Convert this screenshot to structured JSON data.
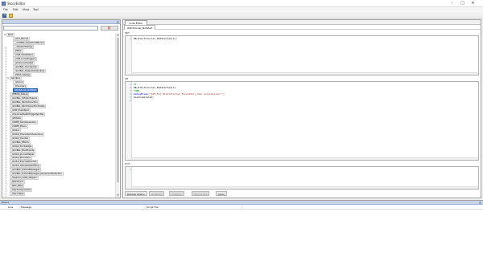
{
  "window": {
    "title": "StoryEditor",
    "controls": [
      "–",
      "□",
      "✕"
    ]
  },
  "menu": [
    "File",
    "Edit",
    "View",
    "Tool"
  ],
  "toolbar": {
    "icons": [
      "save-icon",
      "open-icon"
    ]
  },
  "left_panel": {
    "close_glyph": "✕",
    "search": {
      "value": "",
      "placeholder": ""
    },
    "clear_glyph": "✕",
    "tree": [
      {
        "indent": 0,
        "twisty": "⊟",
        "label": "Root"
      },
      {
        "indent": 2,
        "twisty": "",
        "label": "_GLO_Shroud"
      },
      {
        "indent": 2,
        "twisty": "",
        "label": "__GLOBAL_EquipmentBonus"
      },
      {
        "indent": 2,
        "twisty": "",
        "label": "__DesertoDialogs"
      },
      {
        "indent": 2,
        "twisty": "",
        "label": "_PROC"
      },
      {
        "indent": 2,
        "twisty": "",
        "label": "_CSM_TimeMotion"
      },
      {
        "indent": 2,
        "twisty": "",
        "label": "_CSM_CrimeTriggers"
      },
      {
        "indent": 2,
        "twisty": "",
        "label": "_Global_Activated"
      },
      {
        "indent": 2,
        "twisty": "",
        "label": "_GLOBAL_Quickguide"
      },
      {
        "indent": 2,
        "twisty": "",
        "label": "_GLOBAL_TeleporterSymbols"
      },
      {
        "indent": 2,
        "twisty": "",
        "label": "_PROC_Dialogs"
      },
      {
        "indent": 1,
        "twisty": "⊟",
        "label": "Sandbox"
      },
      {
        "indent": 2,
        "twisty": "",
        "label": "_Shroud"
      },
      {
        "indent": 2,
        "twisty": "",
        "label": "_Discovery"
      },
      {
        "indent": 2,
        "twisty": "",
        "label": "WikiTutorial_NotStart",
        "selected": true
      },
      {
        "indent": 1,
        "twisty": "",
        "label": "_DEBUG_Debug"
      },
      {
        "indent": 1,
        "twisty": "",
        "label": "_GLOBAL_HiddenHelpers"
      },
      {
        "indent": 1,
        "twisty": "",
        "label": "_GLOBAL_ItemInteraction"
      },
      {
        "indent": 1,
        "twisty": "",
        "label": "_GLOBAL_ItemInteractionTooltip"
      },
      {
        "indent": 1,
        "twisty": "",
        "label": "_GTW_PreOutput"
      },
      {
        "indent": 1,
        "twisty": "",
        "label": "_AdvancedDeathTriggerSpotter"
      },
      {
        "indent": 1,
        "twisty": "",
        "label": "_Attitude"
      },
      {
        "indent": 1,
        "twisty": "",
        "label": "_CRIME_ItemOwnership"
      },
      {
        "indent": 1,
        "twisty": "",
        "label": "_CRIME_Prison"
      },
      {
        "indent": 1,
        "twisty": "",
        "label": "_Global"
      },
      {
        "indent": 1,
        "twisty": "",
        "label": "_Global_CharacterInteractions"
      },
      {
        "indent": 1,
        "twisty": "",
        "label": "_Global_Counter"
      },
      {
        "indent": 1,
        "twisty": "",
        "label": "_GLOBAL_Effects"
      },
      {
        "indent": 1,
        "twisty": "",
        "label": "_Global_Knowledge"
      },
      {
        "indent": 1,
        "twisty": "",
        "label": "_GLOBAL_BookEvents"
      },
      {
        "indent": 1,
        "twisty": "",
        "label": "_Global_JournalHelper"
      },
      {
        "indent": 1,
        "twisty": "",
        "label": "_Global_Procedure"
      },
      {
        "indent": 1,
        "twisty": "",
        "label": "_Global_ExecuteProcCtrl"
      },
      {
        "indent": 1,
        "twisty": "",
        "label": "_Global_GameplayProfiling"
      },
      {
        "indent": 1,
        "twisty": "",
        "label": "_GLOBAL_TutorialMessages"
      },
      {
        "indent": 1,
        "twisty": "",
        "label": "_GLOBAL_TutorialMessages_MovementDetection"
      },
      {
        "indent": 1,
        "twisty": "",
        "label": "_Sessions_Little_Helpers"
      },
      {
        "indent": 1,
        "twisty": "",
        "label": "_NPCGuard"
      },
      {
        "indent": 1,
        "twisty": "",
        "label": "_NPC_Base"
      },
      {
        "indent": 1,
        "twisty": "",
        "label": "_PlayerAlignments"
      },
      {
        "indent": 1,
        "twisty": "",
        "label": "_Story Base"
      }
    ]
  },
  "editor": {
    "doc_tab": "Code Editor",
    "file_tab": "WikiTutorial_NotStart",
    "init": {
      "label": "INIT",
      "lines": [
        {
          "n": "1",
          "parts": [
            {
              "t": "DB_WikiTutorial_ModStarted(1);",
              "c": "plain"
            }
          ]
        }
      ]
    },
    "kb": {
      "label": "KB",
      "lines": [
        {
          "n": "1",
          "parts": [
            {
              "t": "IF",
              "c": "comment"
            }
          ]
        },
        {
          "n": "2",
          "parts": [
            {
              "t": "DB_WikiTutorial_ModStarted(1)",
              "c": "plain"
            }
          ]
        },
        {
          "n": "3",
          "parts": [
            {
              "t": "THEN",
              "c": "comment"
            }
          ]
        },
        {
          "n": "4",
          "parts": [
            {
              "t": "DebugBreak",
              "c": "keyword"
            },
            {
              "t": "(\"[WT_FS] WikiTutorial_FirstStory has initialized.\");",
              "c": "string"
            }
          ]
        },
        {
          "n": "5",
          "parts": [
            {
              "t": "GoalCompleted;",
              "c": "plain"
            }
          ]
        },
        {
          "n": "6",
          "parts": []
        }
      ]
    },
    "exit": {
      "label": "EXIT",
      "lines": [
        {
          "n": "1",
          "parts": []
        }
      ]
    },
    "bottom_tabs": [
      {
        "label": "Refresh Status",
        "disabled": false
      },
      {
        "label": "Disabled",
        "disabled": true
      },
      {
        "label": "Initialize",
        "disabled": true
      },
      {
        "label": "Reload File",
        "disabled": true
      },
      {
        "label": "Open",
        "disabled": false
      }
    ]
  },
  "errors": {
    "title": "Errors",
    "close_glyph": "✕",
    "columns": [
      "Line",
      "Message",
      "Script File"
    ]
  }
}
